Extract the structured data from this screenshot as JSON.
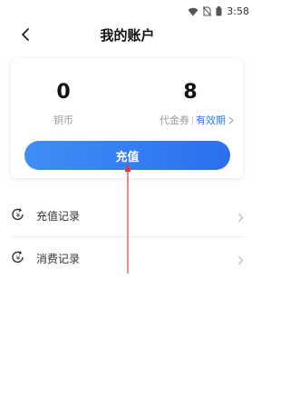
{
  "status_bar": {
    "time": "3:58"
  },
  "header": {
    "title": "我的账户"
  },
  "account": {
    "coins_value": "0",
    "coins_label": "铜币",
    "vouchers_value": "8",
    "vouchers_label": "代金券",
    "validity_link": "有效期"
  },
  "recharge_button": "充值",
  "menu": {
    "items": [
      {
        "label": "充值记录"
      },
      {
        "label": "消费记录"
      }
    ]
  },
  "colors": {
    "accent": "#2b6ff0",
    "link": "#2a7be8",
    "annotation_arrow": "#e53935"
  }
}
